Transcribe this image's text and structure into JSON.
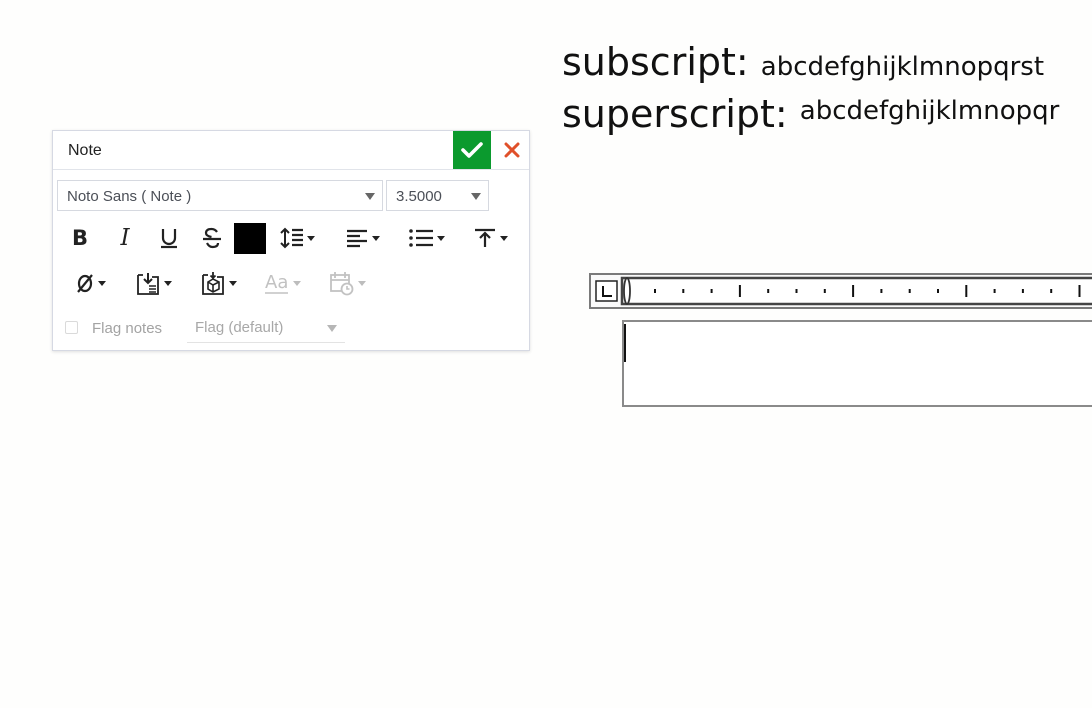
{
  "note_dialog": {
    "title": "Note",
    "font_family_value": "Noto Sans ( Note )",
    "font_size_value": "3.5000",
    "text_color": "#000000",
    "accept_color": "#0b9a2e",
    "cancel_color": "#e0502a",
    "toolbar_icons": [
      "bold-icon",
      "italic-icon",
      "underline-icon",
      "strikethrough-icon",
      "text-color-swatch",
      "line-spacing-icon",
      "align-left-icon",
      "bulleted-list-icon",
      "vertical-align-top-icon",
      "diameter-symbol-icon",
      "insert-reference-icon",
      "insert-part-property-icon",
      "text-case-icon",
      "date-time-icon"
    ],
    "flag_notes_label": "Flag notes",
    "flag_select_value": "Flag (default)"
  },
  "canvas": {
    "subscript_label": "subscript:",
    "subscript_sample": "abcdefghijklmnopqrst",
    "superscript_label": "superscript:",
    "superscript_sample": "abcdefghijklmnopqr"
  }
}
